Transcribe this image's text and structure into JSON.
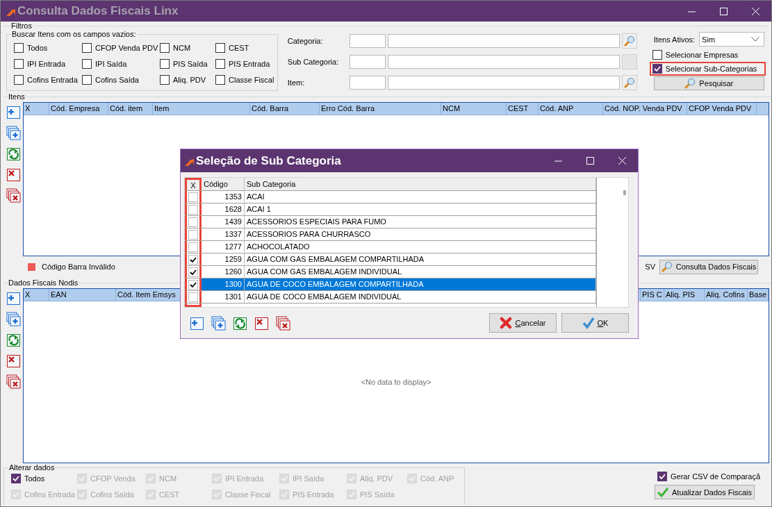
{
  "window": {
    "title": "Consulta Dados Fiscais Linx"
  },
  "filters": {
    "label": "Filtros",
    "empty_fields": {
      "label": "Buscar Itens com os campos vazios:",
      "options": [
        {
          "label": "Todos",
          "checked": false
        },
        {
          "label": "CFOP Venda PDV",
          "checked": false
        },
        {
          "label": "NCM",
          "checked": false
        },
        {
          "label": "CEST",
          "checked": false
        },
        {
          "label": "IPI Entrada",
          "checked": false
        },
        {
          "label": "IPI Saída",
          "checked": false
        },
        {
          "label": "PIS Saída",
          "checked": false
        },
        {
          "label": "PIS Entrada",
          "checked": false
        },
        {
          "label": "Cofins Entrada",
          "checked": false
        },
        {
          "label": "Cofins Saída",
          "checked": false
        },
        {
          "label": "Aliq. PDV",
          "checked": false
        },
        {
          "label": "Classe Fiscal",
          "checked": false
        }
      ]
    },
    "lookups": [
      {
        "label": "Categoria:",
        "search_button": true
      },
      {
        "label": "Sub Categoria:",
        "search_button": false
      },
      {
        "label": "Item:",
        "search_button": true
      }
    ],
    "active_items": {
      "label": "Itens Ativos:",
      "value": "Sim"
    },
    "options": [
      {
        "label": "Selecionar Empresas",
        "checked": false,
        "highlighted": false
      },
      {
        "label": "Selecionar Sub-Categorias",
        "checked": true,
        "highlighted": true
      }
    ],
    "search_button": "Pesquisar"
  },
  "items": {
    "label": "Itens",
    "toolbar": [
      {
        "kind": "add"
      },
      {
        "kind": "add_multiple"
      },
      {
        "kind": "refresh"
      },
      {
        "kind": "delete"
      },
      {
        "kind": "delete_multiple"
      }
    ],
    "columns": [
      "X",
      "Cód. Empresa",
      "Cód. item",
      "Item",
      "Cód. Barra",
      "Erro Cód. Barra",
      "NCM",
      "CEST",
      "Cód. ANP",
      "Cód. NOP. Venda PDV",
      "CFOP Venda PDV"
    ],
    "legend": {
      "label": "Código Barra Inválido",
      "color": "#f05a5a"
    },
    "legend_fragment": "SV",
    "query_button": "Consulta Dados Fiscais"
  },
  "fiscal": {
    "label": "Dados Fiscais Nodis",
    "toolbar": [
      {
        "kind": "add"
      },
      {
        "kind": "add_multiple"
      },
      {
        "kind": "refresh"
      },
      {
        "kind": "delete"
      },
      {
        "kind": "delete_multiple"
      }
    ],
    "columns_left": [
      "X",
      "EAN",
      "Cód. Item Emsys"
    ],
    "columns_right": [
      "PIS C",
      "Aliq. PIS",
      "Aliq. Cofins",
      "Base"
    ],
    "empty_text": "<No data to display>"
  },
  "change": {
    "label": "Alterar dados",
    "options": [
      {
        "label": "Todos",
        "checked": true,
        "disabled": false
      },
      {
        "label": "CFOP Venda",
        "checked": true,
        "disabled": true
      },
      {
        "label": "NCM",
        "checked": true,
        "disabled": true
      },
      {
        "label": "IPI Entrada",
        "checked": true,
        "disabled": true
      },
      {
        "label": "IPI Saída",
        "checked": true,
        "disabled": true
      },
      {
        "label": "Aliq. PDV",
        "checked": true,
        "disabled": true
      },
      {
        "label": "Cód. ANP",
        "checked": true,
        "disabled": true
      },
      {
        "label": "Cofins Entrada",
        "checked": true,
        "disabled": true
      },
      {
        "label": "Cofins Saída",
        "checked": true,
        "disabled": true
      },
      {
        "label": "CEST",
        "checked": true,
        "disabled": true
      },
      {
        "label": "Classe Fiscal",
        "checked": true,
        "disabled": true
      },
      {
        "label": "PIS Entrada",
        "checked": true,
        "disabled": true
      },
      {
        "label": "PIS Saída",
        "checked": true,
        "disabled": true
      }
    ]
  },
  "csv": {
    "label": "Gerar CSV de Comparaçã",
    "checked": true
  },
  "update_button": "Atualizar Dados Fiscais",
  "dialog": {
    "title": "Seleção de Sub Categoria",
    "columns": [
      "X",
      "Código",
      "Sub Categoria"
    ],
    "checkbox_column_highlighted": true,
    "rows": [
      {
        "code": "1353",
        "name": "ACAI",
        "checked": false,
        "selected": false
      },
      {
        "code": "1628",
        "name": "ACAI 1",
        "checked": false,
        "selected": false
      },
      {
        "code": "1439",
        "name": "ACESSORIOS ESPECIAIS PARA FUMO",
        "checked": false,
        "selected": false
      },
      {
        "code": "1337",
        "name": "ACESSORIOS PARA CHURRASCO",
        "checked": false,
        "selected": false
      },
      {
        "code": "1277",
        "name": "ACHOCOLATADO",
        "checked": false,
        "selected": false
      },
      {
        "code": "1259",
        "name": "AGUA COM GAS EMBALAGEM COMPARTILHADA",
        "checked": true,
        "selected": false
      },
      {
        "code": "1260",
        "name": "AGUA COM GAS EMBALAGEM INDIVIDUAL",
        "checked": true,
        "selected": false
      },
      {
        "code": "1300",
        "name": "AGUA DE COCO EMBALAGEM COMPARTILHADA",
        "checked": true,
        "selected": true
      },
      {
        "code": "1301",
        "name": "AGUA DE COCO EMBALAGEM INDIVIDUAL",
        "checked": false,
        "selected": false
      }
    ],
    "toolbar": [
      {
        "kind": "add"
      },
      {
        "kind": "add_multiple"
      },
      {
        "kind": "refresh"
      },
      {
        "kind": "delete"
      },
      {
        "kind": "delete_multiple"
      }
    ],
    "buttons": [
      {
        "label": "Cancelar",
        "kind": "cancel"
      },
      {
        "label": "OK",
        "kind": "ok"
      }
    ]
  }
}
